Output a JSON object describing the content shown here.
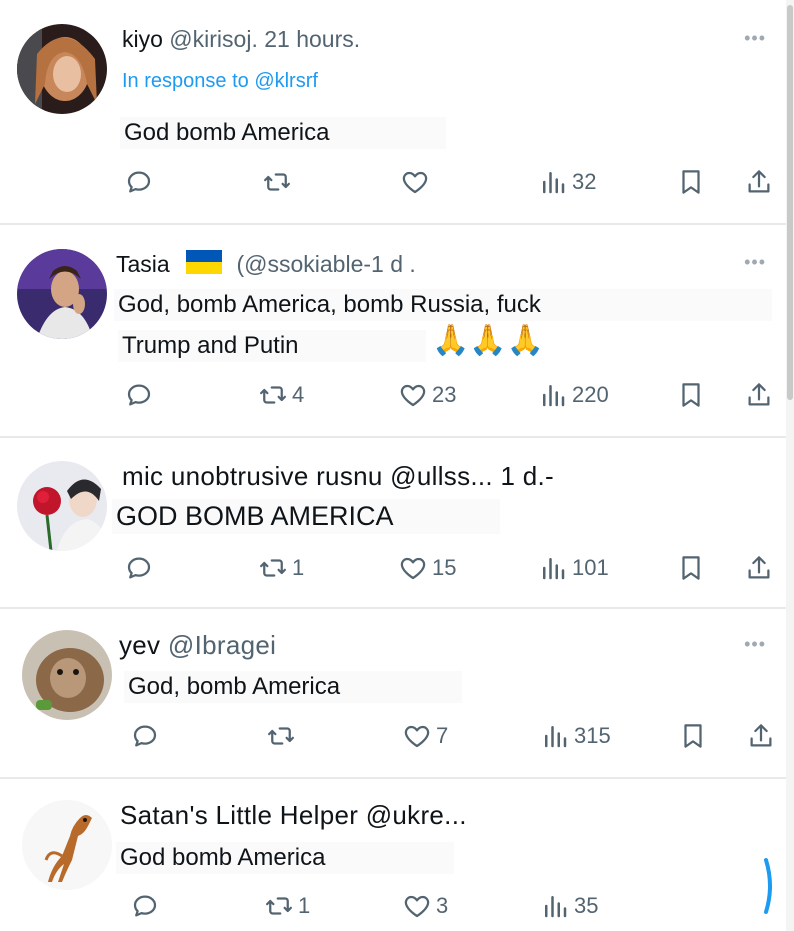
{
  "tweets": [
    {
      "name": "kiyo",
      "handle": "@kirisoj",
      "time": ". 21 hours.",
      "reply_to_prefix": "In response to",
      "reply_to_handle": "@klrsrf",
      "text": "God bomb America",
      "replies": "",
      "retweets": "",
      "likes": "",
      "views": "32"
    },
    {
      "name": "Tasia",
      "handle": "(@ssokiable-1 d .",
      "text_line1": "God, bomb America, bomb Russia, fuck",
      "text_line2": "Trump and Putin",
      "emoji": "🙏🙏🙏",
      "replies": "",
      "retweets": "4",
      "likes": "23",
      "views": "220"
    },
    {
      "name": "mic unobtrusive rusnu",
      "handle": "@ullss... 1 d.-",
      "text": "GOD BOMB AMERICA",
      "replies": "",
      "retweets": "1",
      "likes": "15",
      "views": "101"
    },
    {
      "name": "yev",
      "handle": "@Ibragei",
      "text": "God, bomb America",
      "replies": "",
      "retweets": "",
      "likes": "7",
      "views": "315"
    },
    {
      "name": "Satan's Little Helper",
      "handle": "@ukre...",
      "text": "God bomb America",
      "replies": "",
      "retweets": "1",
      "likes": "3",
      "views": "35"
    }
  ],
  "more_label": "•••",
  "icons": [
    "reply-icon",
    "retweet-icon",
    "like-icon",
    "views-icon",
    "bookmark-icon",
    "share-icon"
  ],
  "colors": {
    "text": "#0f1419",
    "secondary": "#536471",
    "link": "#1d9bf0",
    "divider": "#e7e9ea"
  }
}
